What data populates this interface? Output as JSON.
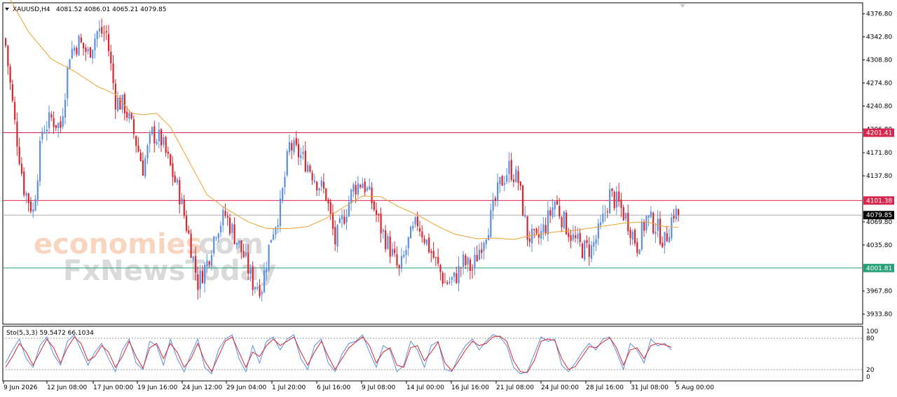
{
  "header": {
    "symbol": "XAUUSD,H4",
    "ohlc": "4081.52 4086.01 4065.21 4079.85"
  },
  "indicator": {
    "label": "Sto(5,3,3) 59.5472 66.1034",
    "levels": [
      "100",
      "80",
      "20",
      "0"
    ]
  },
  "watermark": {
    "line1": "economies",
    "line1b": ".com",
    "line2": "FxNewsToday"
  },
  "colors": {
    "bull": "#5b8fe0",
    "bear": "#d7262e",
    "ma": "#f0a030",
    "resistance": "#d7264e",
    "support": "#2aa07a",
    "price": "#000000",
    "stoch_main": "#5b8fe0",
    "stoch_signal": "#d7262e"
  },
  "chart_data": {
    "type": "candlestick",
    "symbol": "XAUUSD",
    "timeframe": "H4",
    "ylim": [
      3920,
      4392
    ],
    "y_ticks": [
      "4376.80",
      "4342.80",
      "4308.80",
      "4274.80",
      "4240.80",
      "4206.80",
      "4171.80",
      "4137.80",
      "4069.80",
      "4035.80",
      "3967.80",
      "3933.80"
    ],
    "x_labels": [
      "9 Jun 2026",
      "12 Jun 08:00",
      "17 Jun 00:00",
      "19 Jun 16:00",
      "24 Jun 12:00",
      "29 Jun 04:00",
      "1 Jul 20:00",
      "6 Jul 16:00",
      "9 Jul 08:00",
      "14 Jul 00:00",
      "16 Jul 16:00",
      "21 Jul 08:00",
      "24 Jul 00:00",
      "28 Jul 16:00",
      "31 Jul 08:00",
      "5 Aug 00:00"
    ],
    "levels": [
      {
        "label": "4201.41",
        "value": 4201.41,
        "kind": "resistance"
      },
      {
        "label": "4101.38",
        "value": 4101.38,
        "kind": "resistance"
      },
      {
        "label": "4079.85",
        "value": 4079.85,
        "kind": "price"
      },
      {
        "label": "4001.81",
        "value": 4001.81,
        "kind": "support"
      }
    ],
    "close_path": [
      [
        0,
        4330
      ],
      [
        4,
        4215
      ],
      [
        8,
        4120
      ],
      [
        12,
        4085
      ],
      [
        16,
        4205
      ],
      [
        20,
        4222
      ],
      [
        24,
        4210
      ],
      [
        28,
        4320
      ],
      [
        32,
        4335
      ],
      [
        36,
        4318
      ],
      [
        40,
        4350
      ],
      [
        44,
        4348
      ],
      [
        48,
        4250
      ],
      [
        52,
        4240
      ],
      [
        56,
        4200
      ],
      [
        60,
        4150
      ],
      [
        64,
        4200
      ],
      [
        68,
        4190
      ],
      [
        72,
        4150
      ],
      [
        76,
        4110
      ],
      [
        80,
        4050
      ],
      [
        84,
        3980
      ],
      [
        88,
        4010
      ],
      [
        92,
        4060
      ],
      [
        96,
        4080
      ],
      [
        100,
        4050
      ],
      [
        104,
        4020
      ],
      [
        108,
        3980
      ],
      [
        112,
        3975
      ],
      [
        116,
        4050
      ],
      [
        120,
        4090
      ],
      [
        124,
        4182
      ],
      [
        128,
        4170
      ],
      [
        132,
        4155
      ],
      [
        136,
        4130
      ],
      [
        140,
        4110
      ],
      [
        144,
        4040
      ],
      [
        148,
        4080
      ],
      [
        152,
        4120
      ],
      [
        156,
        4130
      ],
      [
        160,
        4100
      ],
      [
        164,
        4060
      ],
      [
        168,
        4030
      ],
      [
        172,
        3995
      ],
      [
        176,
        4040
      ],
      [
        180,
        4070
      ],
      [
        184,
        4040
      ],
      [
        188,
        4010
      ],
      [
        192,
        3980
      ],
      [
        196,
        3985
      ],
      [
        200,
        4010
      ],
      [
        204,
        4000
      ],
      [
        208,
        4040
      ],
      [
        212,
        4075
      ],
      [
        216,
        4125
      ],
      [
        220,
        4150
      ],
      [
        224,
        4130
      ],
      [
        228,
        4050
      ],
      [
        232,
        4040
      ],
      [
        236,
        4065
      ],
      [
        240,
        4100
      ],
      [
        244,
        4070
      ],
      [
        248,
        4045
      ],
      [
        252,
        4030
      ],
      [
        256,
        4030
      ],
      [
        260,
        4060
      ],
      [
        264,
        4110
      ],
      [
        268,
        4095
      ],
      [
        272,
        4070
      ],
      [
        276,
        4035
      ],
      [
        280,
        4075
      ],
      [
        284,
        4065
      ],
      [
        288,
        4040
      ],
      [
        292,
        4085
      ],
      [
        294,
        4080
      ]
    ],
    "ma_path": [
      [
        0,
        4410
      ],
      [
        10,
        4350
      ],
      [
        20,
        4310
      ],
      [
        30,
        4292
      ],
      [
        40,
        4270
      ],
      [
        48,
        4258
      ],
      [
        55,
        4230
      ],
      [
        60,
        4228
      ],
      [
        66,
        4230
      ],
      [
        72,
        4210
      ],
      [
        80,
        4160
      ],
      [
        88,
        4110
      ],
      [
        96,
        4090
      ],
      [
        106,
        4070
      ],
      [
        114,
        4060
      ],
      [
        124,
        4060
      ],
      [
        132,
        4063
      ],
      [
        140,
        4075
      ],
      [
        148,
        4092
      ],
      [
        156,
        4108
      ],
      [
        164,
        4107
      ],
      [
        172,
        4092
      ],
      [
        180,
        4080
      ],
      [
        188,
        4065
      ],
      [
        196,
        4052
      ],
      [
        206,
        4045
      ],
      [
        214,
        4046
      ],
      [
        222,
        4044
      ],
      [
        230,
        4050
      ],
      [
        240,
        4055
      ],
      [
        250,
        4058
      ],
      [
        260,
        4063
      ],
      [
        270,
        4068
      ],
      [
        280,
        4070
      ],
      [
        288,
        4063
      ],
      [
        294,
        4062
      ]
    ],
    "stoch_main_path": [
      [
        0,
        30
      ],
      [
        3,
        60
      ],
      [
        6,
        85
      ],
      [
        9,
        40
      ],
      [
        12,
        20
      ],
      [
        15,
        70
      ],
      [
        18,
        90
      ],
      [
        21,
        50
      ],
      [
        24,
        25
      ],
      [
        27,
        80
      ],
      [
        30,
        95
      ],
      [
        33,
        60
      ],
      [
        36,
        25
      ],
      [
        39,
        55
      ],
      [
        42,
        75
      ],
      [
        45,
        40
      ],
      [
        48,
        10
      ],
      [
        51,
        60
      ],
      [
        54,
        85
      ],
      [
        57,
        30
      ],
      [
        60,
        15
      ],
      [
        63,
        80
      ],
      [
        66,
        70
      ],
      [
        69,
        25
      ],
      [
        72,
        85
      ],
      [
        75,
        40
      ],
      [
        78,
        10
      ],
      [
        81,
        50
      ],
      [
        84,
        85
      ],
      [
        87,
        20
      ],
      [
        90,
        5
      ],
      [
        93,
        60
      ],
      [
        96,
        85
      ],
      [
        99,
        95
      ],
      [
        102,
        40
      ],
      [
        105,
        10
      ],
      [
        108,
        70
      ],
      [
        111,
        30
      ],
      [
        114,
        80
      ],
      [
        117,
        90
      ],
      [
        120,
        60
      ],
      [
        123,
        85
      ],
      [
        126,
        95
      ],
      [
        129,
        40
      ],
      [
        132,
        15
      ],
      [
        135,
        70
      ],
      [
        138,
        85
      ],
      [
        141,
        30
      ],
      [
        144,
        10
      ],
      [
        147,
        50
      ],
      [
        150,
        75
      ],
      [
        153,
        80
      ],
      [
        156,
        95
      ],
      [
        159,
        55
      ],
      [
        162,
        20
      ],
      [
        165,
        70
      ],
      [
        168,
        60
      ],
      [
        171,
        10
      ],
      [
        174,
        25
      ],
      [
        177,
        80
      ],
      [
        180,
        60
      ],
      [
        183,
        20
      ],
      [
        186,
        70
      ],
      [
        189,
        80
      ],
      [
        192,
        15
      ],
      [
        195,
        10
      ],
      [
        198,
        45
      ],
      [
        201,
        70
      ],
      [
        204,
        85
      ],
      [
        207,
        60
      ],
      [
        210,
        80
      ],
      [
        213,
        95
      ],
      [
        216,
        90
      ],
      [
        219,
        70
      ],
      [
        222,
        20
      ],
      [
        225,
        5
      ],
      [
        228,
        10
      ],
      [
        231,
        50
      ],
      [
        234,
        90
      ],
      [
        237,
        80
      ],
      [
        240,
        85
      ],
      [
        243,
        25
      ],
      [
        246,
        10
      ],
      [
        249,
        30
      ],
      [
        252,
        55
      ],
      [
        255,
        75
      ],
      [
        258,
        60
      ],
      [
        261,
        85
      ],
      [
        264,
        90
      ],
      [
        267,
        55
      ],
      [
        270,
        15
      ],
      [
        273,
        75
      ],
      [
        276,
        60
      ],
      [
        279,
        30
      ],
      [
        282,
        85
      ],
      [
        285,
        70
      ],
      [
        288,
        75
      ],
      [
        291,
        60
      ]
    ],
    "stoch_signal_path": [
      [
        0,
        20
      ],
      [
        3,
        45
      ],
      [
        6,
        75
      ],
      [
        9,
        55
      ],
      [
        12,
        25
      ],
      [
        15,
        55
      ],
      [
        18,
        85
      ],
      [
        21,
        65
      ],
      [
        24,
        30
      ],
      [
        27,
        65
      ],
      [
        30,
        90
      ],
      [
        33,
        75
      ],
      [
        36,
        35
      ],
      [
        39,
        45
      ],
      [
        42,
        70
      ],
      [
        45,
        55
      ],
      [
        48,
        20
      ],
      [
        51,
        45
      ],
      [
        54,
        80
      ],
      [
        57,
        45
      ],
      [
        60,
        18
      ],
      [
        63,
        65
      ],
      [
        66,
        75
      ],
      [
        69,
        40
      ],
      [
        72,
        75
      ],
      [
        75,
        55
      ],
      [
        78,
        20
      ],
      [
        81,
        40
      ],
      [
        84,
        75
      ],
      [
        87,
        35
      ],
      [
        90,
        10
      ],
      [
        93,
        45
      ],
      [
        96,
        80
      ],
      [
        99,
        90
      ],
      [
        102,
        55
      ],
      [
        105,
        20
      ],
      [
        108,
        55
      ],
      [
        111,
        45
      ],
      [
        114,
        70
      ],
      [
        117,
        85
      ],
      [
        120,
        70
      ],
      [
        123,
        80
      ],
      [
        126,
        90
      ],
      [
        129,
        55
      ],
      [
        132,
        25
      ],
      [
        135,
        55
      ],
      [
        138,
        80
      ],
      [
        141,
        45
      ],
      [
        144,
        15
      ],
      [
        147,
        40
      ],
      [
        150,
        65
      ],
      [
        153,
        78
      ],
      [
        156,
        90
      ],
      [
        159,
        70
      ],
      [
        162,
        30
      ],
      [
        165,
        55
      ],
      [
        168,
        65
      ],
      [
        171,
        25
      ],
      [
        174,
        20
      ],
      [
        177,
        65
      ],
      [
        180,
        70
      ],
      [
        183,
        35
      ],
      [
        186,
        55
      ],
      [
        189,
        78
      ],
      [
        192,
        30
      ],
      [
        195,
        12
      ],
      [
        198,
        35
      ],
      [
        201,
        60
      ],
      [
        204,
        80
      ],
      [
        207,
        70
      ],
      [
        210,
        75
      ],
      [
        213,
        90
      ],
      [
        216,
        92
      ],
      [
        219,
        80
      ],
      [
        222,
        35
      ],
      [
        225,
        10
      ],
      [
        228,
        8
      ],
      [
        231,
        35
      ],
      [
        234,
        80
      ],
      [
        237,
        85
      ],
      [
        240,
        82
      ],
      [
        243,
        40
      ],
      [
        246,
        15
      ],
      [
        249,
        22
      ],
      [
        252,
        45
      ],
      [
        255,
        68
      ],
      [
        258,
        65
      ],
      [
        261,
        78
      ],
      [
        264,
        88
      ],
      [
        267,
        65
      ],
      [
        270,
        25
      ],
      [
        273,
        60
      ],
      [
        276,
        65
      ],
      [
        279,
        40
      ],
      [
        282,
        70
      ],
      [
        285,
        75
      ],
      [
        288,
        72
      ],
      [
        291,
        66
      ]
    ]
  }
}
